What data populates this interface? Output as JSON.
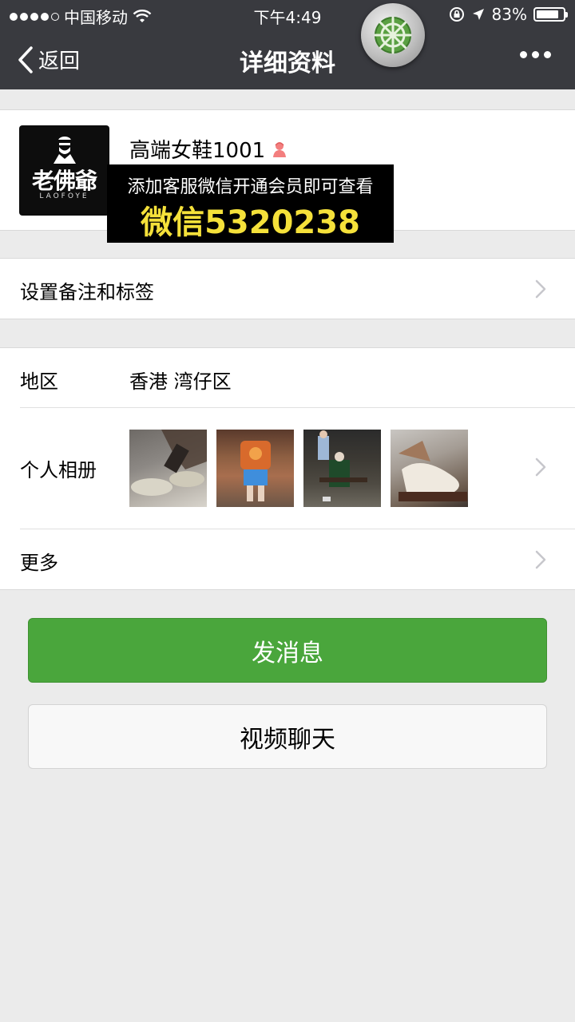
{
  "status_bar": {
    "carrier": "中国移动",
    "time": "下午4:49",
    "battery_text": "83%",
    "battery_level": 0.83
  },
  "nav": {
    "back_label": "返回",
    "title": "详细资料"
  },
  "profile": {
    "avatar_logo_zh": "老佛爺",
    "avatar_logo_en": "LAOFOYE",
    "nickname": "高端女鞋1001",
    "promo_line1": "添加客服微信开通会员即可查看",
    "promo_line2": "微信5320238"
  },
  "cells": {
    "remark": {
      "label": "设置备注和标签"
    },
    "region": {
      "label": "地区",
      "value": "香港 湾仔区"
    },
    "album": {
      "label": "个人相册"
    },
    "more": {
      "label": "更多"
    }
  },
  "buttons": {
    "send_message": "发消息",
    "video_call": "视频聊天"
  },
  "colors": {
    "nav_bg": "#393a3f",
    "primary_green": "#4aa63c",
    "promo_yellow": "#f5e13a",
    "page_bg": "#ebebeb"
  }
}
